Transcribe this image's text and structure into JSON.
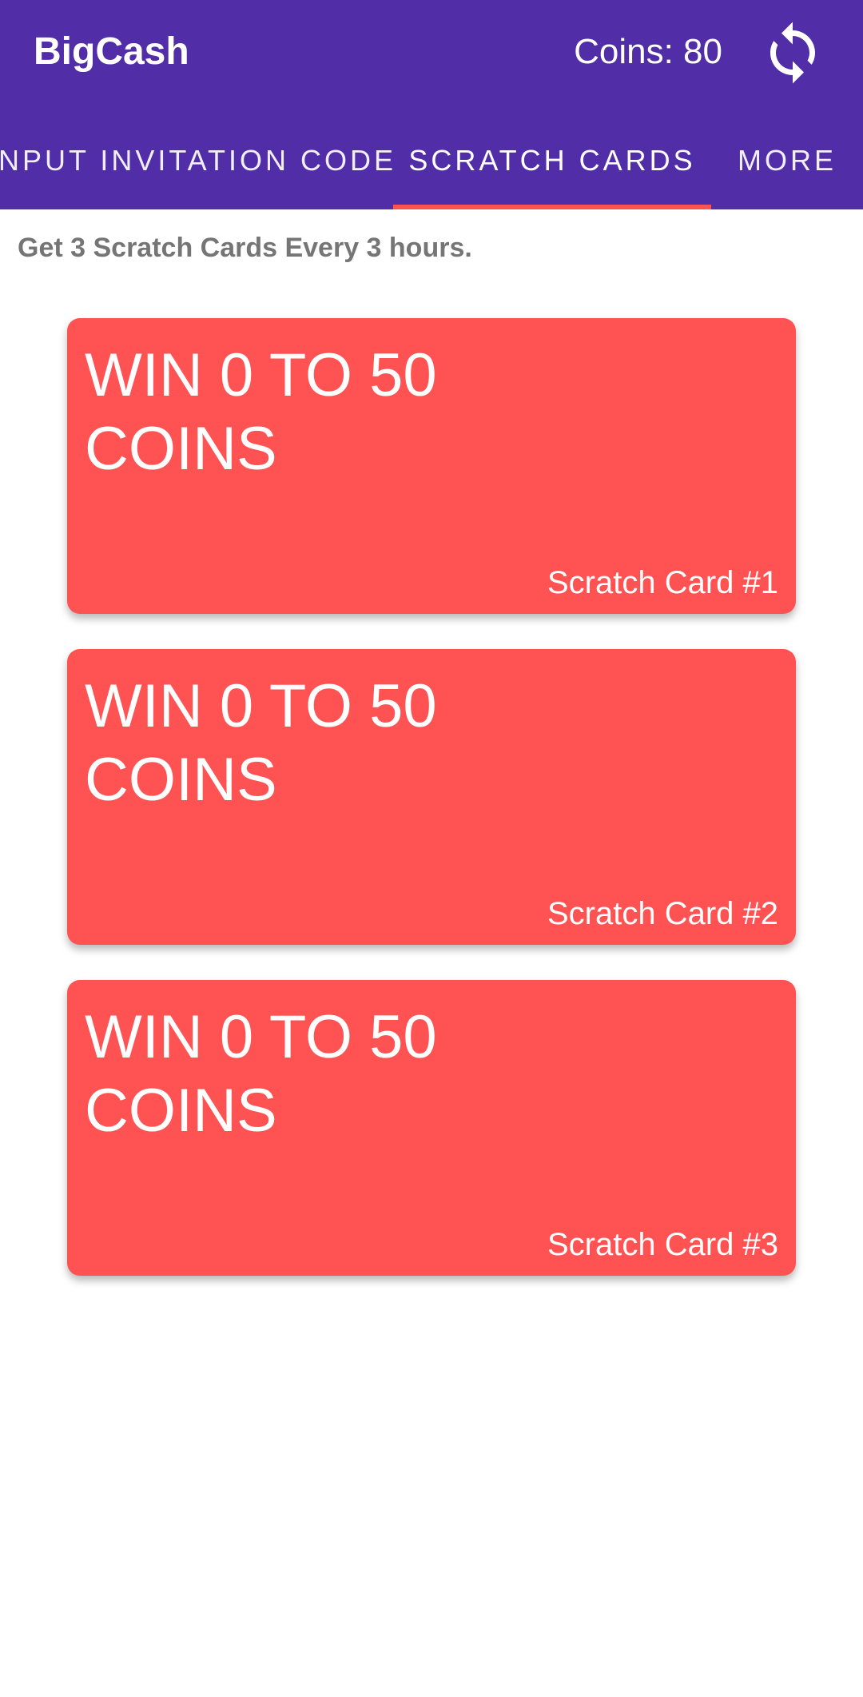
{
  "app": {
    "title": "BigCash",
    "coins_label": "Coins: 80",
    "refresh_icon": "refresh-icon"
  },
  "tabs": [
    {
      "label": "INPUT INVITATION CODE",
      "selected": false
    },
    {
      "label": "SCRATCH CARDS",
      "selected": true
    },
    {
      "label": "MORE",
      "selected": false
    }
  ],
  "colors": {
    "app_bar": "#512DA8",
    "tab_indicator": "#FF5252",
    "card": "#FF5252",
    "subtitle": "#757575"
  },
  "main": {
    "subtitle": "Get 3 Scratch Cards Every 3 hours.",
    "cards": [
      {
        "headline": "WIN 0 TO 50 COINS",
        "label": "Scratch Card #1"
      },
      {
        "headline": "WIN 0 TO 50 COINS",
        "label": "Scratch Card #2"
      },
      {
        "headline": "WIN 0 TO 50 COINS",
        "label": "Scratch Card #3"
      }
    ]
  }
}
